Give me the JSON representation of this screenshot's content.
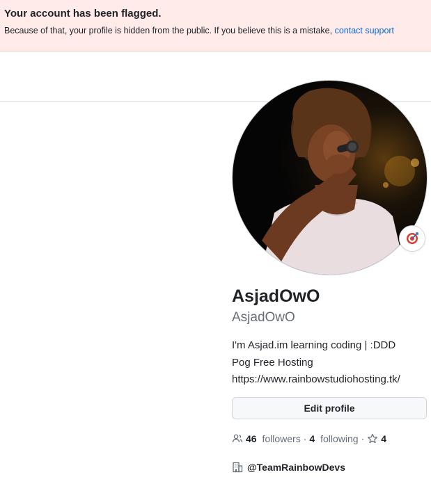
{
  "flash": {
    "title": "Your account has been flagged.",
    "message": "Because of that, your profile is hidden from the public. If you believe this is a mistake, ",
    "link_text": "contact support"
  },
  "profile": {
    "display_name": "AsjadOwO",
    "username": "AsjadOwO",
    "bio_lines": [
      "I'm Asjad.im learning coding | :DDD",
      "Pog Free Hosting",
      "https://www.rainbowstudiohosting.tk/"
    ],
    "edit_button_label": "Edit profile",
    "followers_count": "46",
    "followers_label": "followers",
    "following_count": "4",
    "following_label": "following",
    "stars_count": "4",
    "organization": "@TeamRainbowDevs",
    "status_icon": "target-icon"
  },
  "colors": {
    "flash_bg": "#ffebe9",
    "link": "#0969da",
    "muted": "#656d76",
    "text": "#1f2328",
    "border": "#d0d7de"
  }
}
